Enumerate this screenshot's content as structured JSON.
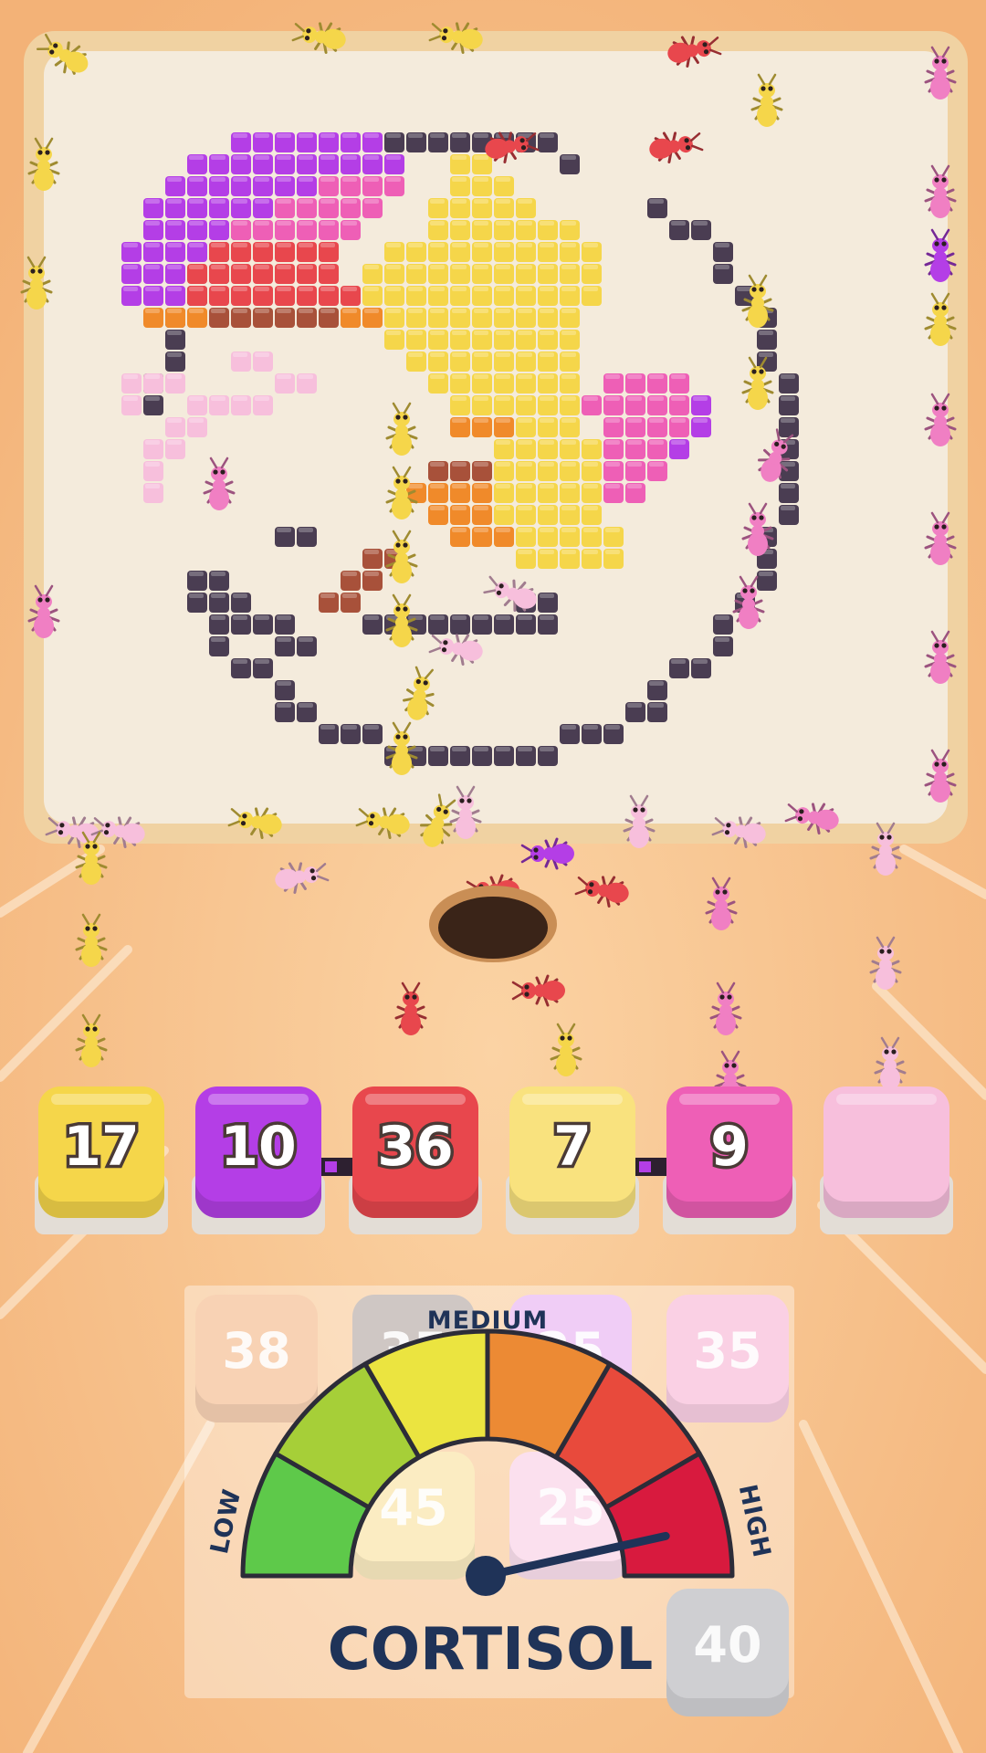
{
  "colors": {
    "background": "#f6c184",
    "board": "#f4ebdc",
    "outline": "#4a3d52",
    "yellow": "#f5d64a",
    "purple": "#b43ee6",
    "red": "#e8474d",
    "pale_yellow": "#f9e27e",
    "pink": "#ee5fb6",
    "light_pink": "#f7bfdc"
  },
  "slots": [
    {
      "count": "17",
      "color": "yellow"
    },
    {
      "count": "10",
      "color": "purple"
    },
    {
      "count": "36",
      "color": "red"
    },
    {
      "count": "7",
      "color": "pale_yellow"
    },
    {
      "count": "9",
      "color": "pink"
    },
    {
      "count": "",
      "color": "light_pink"
    }
  ],
  "queue": [
    {
      "count": "38",
      "color": "#f8d2b4"
    },
    {
      "count": "35",
      "color": "#cfc7c4"
    },
    {
      "count": "25",
      "color": "#f0cdf6"
    },
    {
      "count": "35",
      "color": "#fad0e4"
    },
    {
      "count": "45",
      "color": "#fbecc2"
    },
    {
      "count": "25",
      "color": "#fbe0ee"
    },
    {
      "count": "40",
      "color": "#cfcfd2"
    }
  ],
  "gauge": {
    "title": "CORTISOL",
    "low_label": "LOW",
    "medium_label": "MEDIUM",
    "high_label": "HIGH",
    "level": 0.93
  },
  "board": {
    "picture": "pixel-art fish and flower"
  }
}
